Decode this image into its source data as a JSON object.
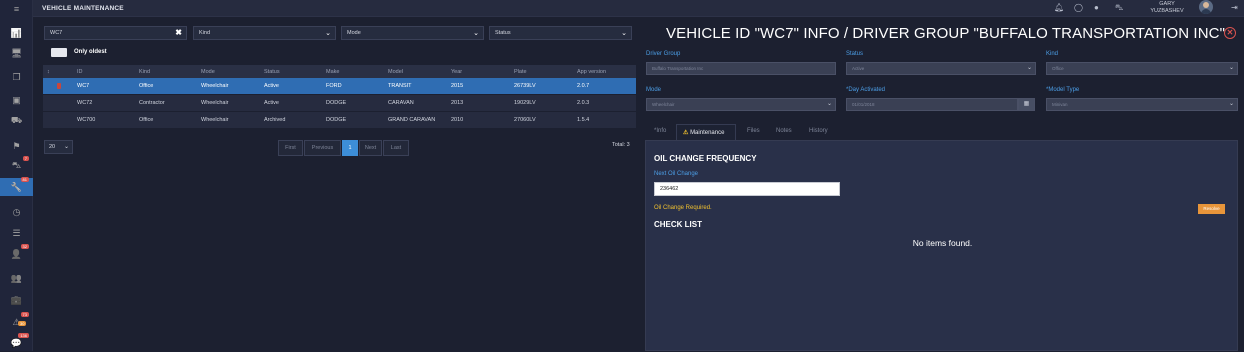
{
  "app": {
    "title": "VEHICLE MAINTENANCE"
  },
  "user": {
    "first_name": "GARY",
    "last_name": "YUZBASHEV"
  },
  "sidebar": {
    "items": [
      {
        "icon": "menu-icon",
        "glyph": "≡",
        "active": false,
        "badge": ""
      },
      {
        "icon": "chart-icon",
        "glyph": "📊",
        "active": false,
        "badge": ""
      },
      {
        "icon": "monitor-icon",
        "glyph": "🖥",
        "active": false,
        "badge": ""
      },
      {
        "icon": "copy-icon",
        "glyph": "❐",
        "active": false,
        "badge": ""
      },
      {
        "icon": "bus-icon",
        "glyph": "▣",
        "active": false,
        "badge": ""
      },
      {
        "icon": "car-front-icon",
        "glyph": "⛟",
        "active": false,
        "badge": ""
      },
      {
        "icon": "flag-icon",
        "glyph": "⚑",
        "active": false,
        "badge": ""
      },
      {
        "icon": "car-icon",
        "glyph": "⛍",
        "active": false,
        "badge": "7"
      },
      {
        "icon": "wrench-icon",
        "glyph": "🔧",
        "active": true,
        "badge": "81"
      },
      {
        "icon": "clock-icon",
        "glyph": "◷",
        "active": false,
        "badge": ""
      },
      {
        "icon": "list-icon",
        "glyph": "☰",
        "active": false,
        "badge": ""
      },
      {
        "icon": "person-icon",
        "glyph": "👤",
        "active": false,
        "badge": "32"
      },
      {
        "icon": "group-icon",
        "glyph": "👥",
        "active": false,
        "badge": ""
      },
      {
        "icon": "briefcase-icon",
        "glyph": "💼",
        "active": false,
        "badge": ""
      },
      {
        "icon": "alert-icon",
        "glyph": "⚠",
        "active": false,
        "badge": "73"
      },
      {
        "icon": "chat-icon",
        "glyph": "💬",
        "active": false,
        "badge": "136"
      }
    ],
    "secondary_badge": "30"
  },
  "filters": {
    "search": {
      "value": "WC7"
    },
    "kind": {
      "value": "Kind"
    },
    "mode": {
      "value": "Mode"
    },
    "status": {
      "value": "Status"
    },
    "only_oldest_label": "Only oldest"
  },
  "table": {
    "columns": [
      "↕",
      "ID",
      "Kind",
      "Mode",
      "Status",
      "Make",
      "Model",
      "Year",
      "Plate",
      "App version"
    ],
    "rows": [
      {
        "id": "WC7",
        "kind": "Office",
        "mode": "Wheelchair",
        "status": "Active",
        "make": "FORD",
        "model": "TRANSIT",
        "year": "2015",
        "plate": "26739LV",
        "app_version": "2.0.7",
        "selected": true,
        "marker": true
      },
      {
        "id": "WC72",
        "kind": "Contractor",
        "mode": "Wheelchair",
        "status": "Active",
        "make": "DODGE",
        "model": "CARAVAN",
        "year": "2013",
        "plate": "19029LV",
        "app_version": "2.0.3",
        "selected": false,
        "marker": false
      },
      {
        "id": "WC700",
        "kind": "Office",
        "mode": "Wheelchair",
        "status": "Archived",
        "make": "DODGE",
        "model": "GRAND CARAVAN",
        "year": "2010",
        "plate": "27060LV",
        "app_version": "1.5.4",
        "selected": false,
        "marker": false
      }
    ]
  },
  "pagination": {
    "page_size": "20",
    "first": "First",
    "previous": "Previous",
    "current": "1",
    "next": "Next",
    "last": "Last",
    "total": "Total: 3"
  },
  "detail": {
    "title": "VEHICLE ID \"WC7\" INFO / DRIVER GROUP \"BUFFALO TRANSPORTATION INC\"",
    "fields": {
      "driver_group": {
        "label": "Driver Group",
        "value": "Buffalo Transportation Inc"
      },
      "status": {
        "label": "Status",
        "value": "Active"
      },
      "kind": {
        "label": "Kind",
        "value": "Office"
      },
      "mode": {
        "label": "Mode",
        "value": "Wheelchair"
      },
      "day_activated": {
        "label": "*Day Activated",
        "value": "01/01/2018"
      },
      "model_type": {
        "label": "*Model Type",
        "value": "Minivan"
      }
    },
    "tabs": [
      "*Info",
      "Maintenance",
      "Files",
      "Notes",
      "History"
    ],
    "active_tab": "Maintenance",
    "maintenance": {
      "oil_heading": "OIL CHANGE FREQUENCY",
      "next_oil_label": "Next Oil Change",
      "next_oil_value": "236462",
      "oil_required": "Oil Change Required.",
      "resolve_label": "Resolve",
      "checklist_heading": "CHECK LIST",
      "no_items": "No items found."
    }
  },
  "colors": {
    "accent": "#2f6db3",
    "label_blue": "#4c9ee6",
    "warning": "#f0c02f",
    "badge_red": "#d9534f",
    "resolve_orange": "#e8953a"
  }
}
